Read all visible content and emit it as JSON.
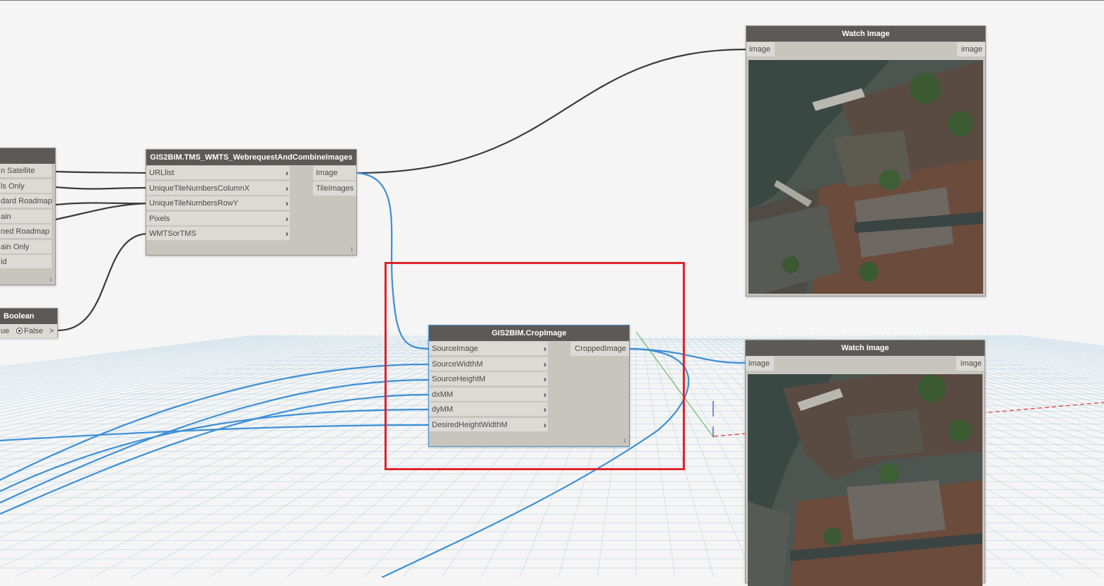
{
  "colors": {
    "canvas": "#f5f5f5",
    "node_header": "#5c5a57",
    "node_body": "#c8c5bf",
    "port_bg": "#dcdad5",
    "wire_dark": "#3c3c3c",
    "wire_blue": "#3d8fd6",
    "highlight_red": "#e0232b",
    "grid_line": "#b9d5e6"
  },
  "dropdown_node": {
    "items": [
      "n Satellite",
      "ls Only",
      "dard Roadmap",
      "ain",
      "ned Roadmap",
      "ain Only",
      "id"
    ],
    "lacing": "l"
  },
  "boolean_node": {
    "title": "Boolean",
    "true_label": "ue",
    "false_label": "False",
    "output_label": ">"
  },
  "tms_node": {
    "title": "GIS2BIM.TMS_WMTS_WebrequestAndCombineImages",
    "inputs": [
      "URLlist",
      "UniqueTileNumbersColumnX",
      "UniqueTileNumbersRowY",
      "Pixels",
      "WMTSorTMS"
    ],
    "outputs": [
      "Image",
      "TileImages"
    ],
    "lacing": "l"
  },
  "crop_node": {
    "title": "GIS2BIM.CropImage",
    "inputs": [
      "SourceImage",
      "SourceWidthM",
      "SourceHeightM",
      "dxMM",
      "dyMM",
      "DesiredHeightWidthM"
    ],
    "outputs": [
      "CroppedImage"
    ],
    "lacing": "l"
  },
  "watch_image_1": {
    "title": "Watch Image",
    "input": "image",
    "output": "image"
  },
  "watch_image_2": {
    "title": "Watch Image",
    "input": "image",
    "output": "image"
  }
}
